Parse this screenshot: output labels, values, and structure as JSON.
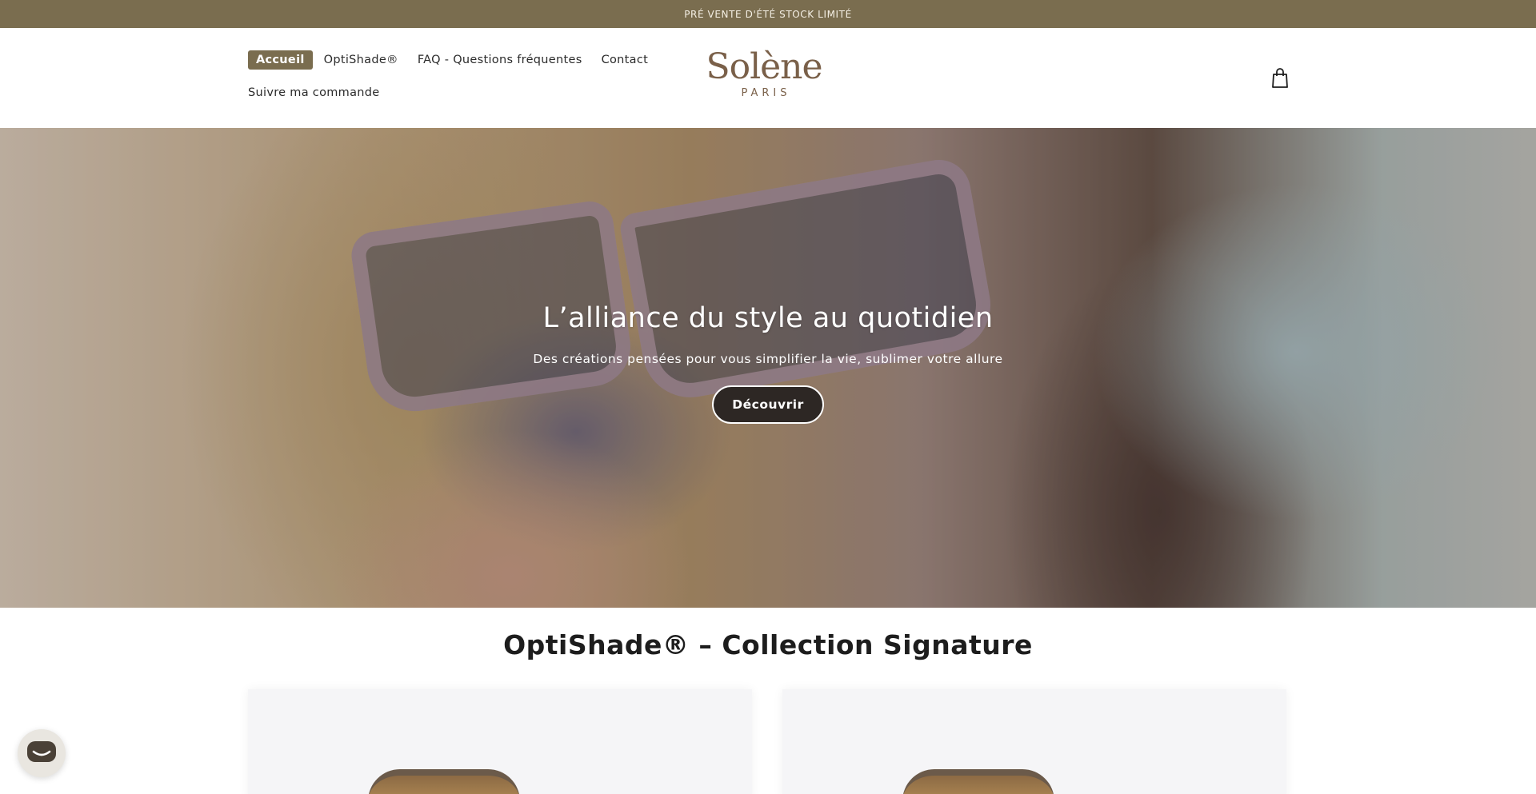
{
  "announcement": {
    "text": "PRÉ VENTE D'ÉTÉ  STOCK LIMITÉ"
  },
  "header": {
    "nav": [
      {
        "label": "Accueil",
        "active": true
      },
      {
        "label": "OptiShade®",
        "active": false
      },
      {
        "label": "FAQ - Questions fréquentes",
        "active": false
      },
      {
        "label": "Contact",
        "active": false
      },
      {
        "label": "Suivre ma commande",
        "active": false
      }
    ],
    "logo": {
      "main": "Solène",
      "sub": "PARIS"
    },
    "cart_icon": "shopping-bag-icon"
  },
  "hero": {
    "title": "L’alliance du style au quotidien",
    "subtitle": "Des créations pensées pour vous simplifier la vie, sublimer votre allure",
    "button_label": "Découvrir"
  },
  "collection": {
    "title": "OptiShade® – Collection Signature",
    "cards": [
      {
        "image": "sunglasses-product-image"
      },
      {
        "image": "sunglasses-product-image"
      }
    ]
  },
  "chat": {
    "icon": "chat-bubble-icon"
  },
  "colors": {
    "accent": "#7a6d4f",
    "logo": "#7a6049",
    "hero_button": "#2d2724"
  }
}
